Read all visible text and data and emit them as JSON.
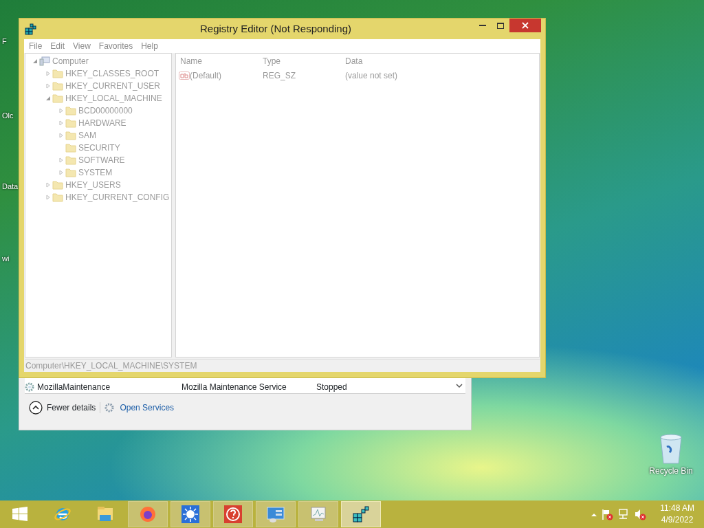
{
  "desktop_icons": [
    {
      "label": "F"
    },
    {
      "label": "Olc"
    },
    {
      "label": "Data"
    },
    {
      "label": "wi"
    }
  ],
  "recycle_bin": {
    "label": "Recycle Bin"
  },
  "task_manager": {
    "rows": [
      {
        "name": "MozillaMaintenance",
        "description": "Mozilla Maintenance Service",
        "status": "Stopped"
      }
    ],
    "fewer_details": "Fewer details",
    "open_services": "Open Services"
  },
  "registry_editor": {
    "title": "Registry Editor (Not Responding)",
    "menu": [
      "File",
      "Edit",
      "View",
      "Favorites",
      "Help"
    ],
    "tree": [
      {
        "label": "Computer",
        "kind": "computer",
        "expandable": true,
        "expanded": true,
        "children": [
          {
            "label": "HKEY_CLASSES_ROOT",
            "kind": "folder",
            "expandable": true,
            "expanded": false
          },
          {
            "label": "HKEY_CURRENT_USER",
            "kind": "folder",
            "expandable": true,
            "expanded": false
          },
          {
            "label": "HKEY_LOCAL_MACHINE",
            "kind": "folder",
            "expandable": true,
            "expanded": true,
            "children": [
              {
                "label": "BCD00000000",
                "kind": "folder",
                "expandable": true,
                "expanded": false
              },
              {
                "label": "HARDWARE",
                "kind": "folder",
                "expandable": true,
                "expanded": false
              },
              {
                "label": "SAM",
                "kind": "folder",
                "expandable": true,
                "expanded": false
              },
              {
                "label": "SECURITY",
                "kind": "folder",
                "expandable": false
              },
              {
                "label": "SOFTWARE",
                "kind": "folder",
                "expandable": true,
                "expanded": false
              },
              {
                "label": "SYSTEM",
                "kind": "folder",
                "expandable": true,
                "expanded": false
              }
            ]
          },
          {
            "label": "HKEY_USERS",
            "kind": "folder",
            "expandable": true,
            "expanded": false
          },
          {
            "label": "HKEY_CURRENT_CONFIG",
            "kind": "folder",
            "expandable": true,
            "expanded": false
          }
        ]
      }
    ],
    "columns": [
      "Name",
      "Type",
      "Data"
    ],
    "values": [
      {
        "name": "(Default)",
        "type": "REG_SZ",
        "data": "(value not set)"
      }
    ],
    "status_path": "Computer\\HKEY_LOCAL_MACHINE\\SYSTEM"
  },
  "taskbar": {
    "items": [
      {
        "kind": "start",
        "running": false,
        "active": false
      },
      {
        "kind": "browser-e",
        "running": false,
        "active": false
      },
      {
        "kind": "files",
        "running": false,
        "active": false
      },
      {
        "kind": "firefox",
        "running": true,
        "active": false
      },
      {
        "kind": "sun",
        "running": true,
        "active": false
      },
      {
        "kind": "help",
        "running": true,
        "active": false
      },
      {
        "kind": "panel",
        "running": true,
        "active": false
      },
      {
        "kind": "monitor",
        "running": true,
        "active": false
      },
      {
        "kind": "cubes",
        "running": true,
        "active": true
      }
    ],
    "time": "11:48 AM",
    "date": "4/9/2022"
  }
}
